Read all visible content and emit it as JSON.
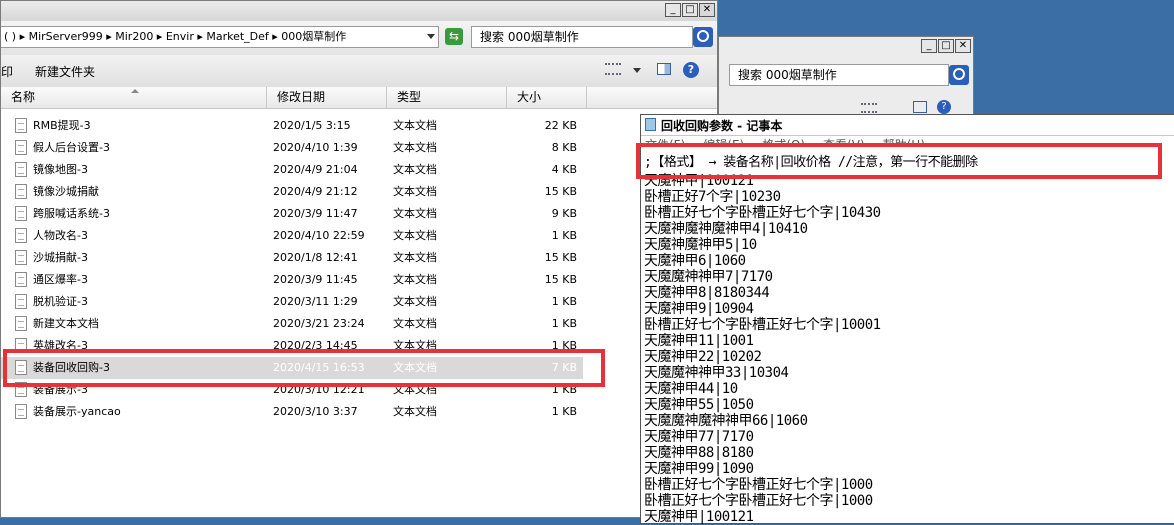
{
  "explorer": {
    "address_path": "( ) ▸ MirServer999 ▸ Mir200 ▸ Envir ▸ Market_Def ▸ 000烟草制作",
    "search_text": "搜索 000烟草制作",
    "toolbar": {
      "print_label": "打印",
      "new_folder_label": "新建文件夹"
    },
    "columns": {
      "name": "名称",
      "date": "修改日期",
      "type": "类型",
      "size": "大小"
    },
    "files": [
      {
        "name": "RMB提现-3",
        "date": "2020/1/5 3:15",
        "type": "文本文档",
        "size": "22 KB"
      },
      {
        "name": "假人后台设置-3",
        "date": "2020/4/10 1:39",
        "type": "文本文档",
        "size": "8 KB"
      },
      {
        "name": "镜像地图-3",
        "date": "2020/4/9 21:04",
        "type": "文本文档",
        "size": "4 KB"
      },
      {
        "name": "镜像沙城捐献",
        "date": "2020/4/9 21:12",
        "type": "文本文档",
        "size": "15 KB"
      },
      {
        "name": "跨服喊话系统-3",
        "date": "2020/3/9 11:47",
        "type": "文本文档",
        "size": "9 KB"
      },
      {
        "name": "人物改名-3",
        "date": "2020/4/10 22:59",
        "type": "文本文档",
        "size": "1 KB"
      },
      {
        "name": "沙城捐献-3",
        "date": "2020/1/8 12:41",
        "type": "文本文档",
        "size": "15 KB"
      },
      {
        "name": "通区爆率-3",
        "date": "2020/3/9 11:45",
        "type": "文本文档",
        "size": "15 KB"
      },
      {
        "name": "脱机验证-3",
        "date": "2020/3/11 1:29",
        "type": "文本文档",
        "size": "1 KB"
      },
      {
        "name": "新建文本文档",
        "date": "2020/3/21 23:24",
        "type": "文本文档",
        "size": "1 KB"
      },
      {
        "name": "英雄改名-3",
        "date": "2020/2/3 14:45",
        "type": "文本文档",
        "size": "1 KB"
      },
      {
        "name": "装备回收回购-3",
        "date": "2020/4/15 16:53",
        "type": "文本文档",
        "size": "7 KB"
      },
      {
        "name": "装备展示-3",
        "date": "2020/3/10 12:21",
        "type": "文本文档",
        "size": "1 KB"
      },
      {
        "name": "装备展示-yancao",
        "date": "2020/3/10 3:37",
        "type": "文本文档",
        "size": "1 KB"
      }
    ]
  },
  "explorer2": {
    "search_text": "搜索 000烟草制作"
  },
  "window_buttons": {
    "minimize": "_",
    "maximize": "□",
    "close": "✕"
  },
  "notepad": {
    "title": "回收回购参数 - 记事本",
    "menu": [
      "文件(F)",
      "编辑(E)",
      "格式(O)",
      "查看(V)",
      "帮助(H)"
    ],
    "lines": [
      ";【格式】 →    装备名称|回收价格       //注意，第一行不能删除",
      "天魔神甲|100121",
      "卧槽正好7个字|10230",
      "卧槽正好七个字卧槽正好七个字|10430",
      "天魔神魔神魔神甲4|10410",
      "天魔神魔神甲5|10",
      "天魔神甲6|1060",
      "天魔魔神神甲7|7170",
      "天魔神甲8|8180344",
      "天魔神甲9|10904",
      "卧槽正好七个字卧槽正好七个字|10001",
      "天魔神甲11|1001",
      "天魔神甲22|10202",
      "天魔魔神神甲33|10304",
      "天魔神甲44|10",
      "天魔神甲55|1050",
      "天魔魔神魔神神甲66|1060",
      "天魔神甲77|7170",
      "天魔神甲88|8180",
      "天魔神甲99|1090",
      "卧槽正好七个字卧槽正好七个字|1000",
      "卧槽正好七个字卧槽正好七个字|1000",
      "天魔神甲|100121"
    ]
  },
  "colors": {
    "highlight": "#e8323a",
    "desktop": "#3a6ea5"
  }
}
